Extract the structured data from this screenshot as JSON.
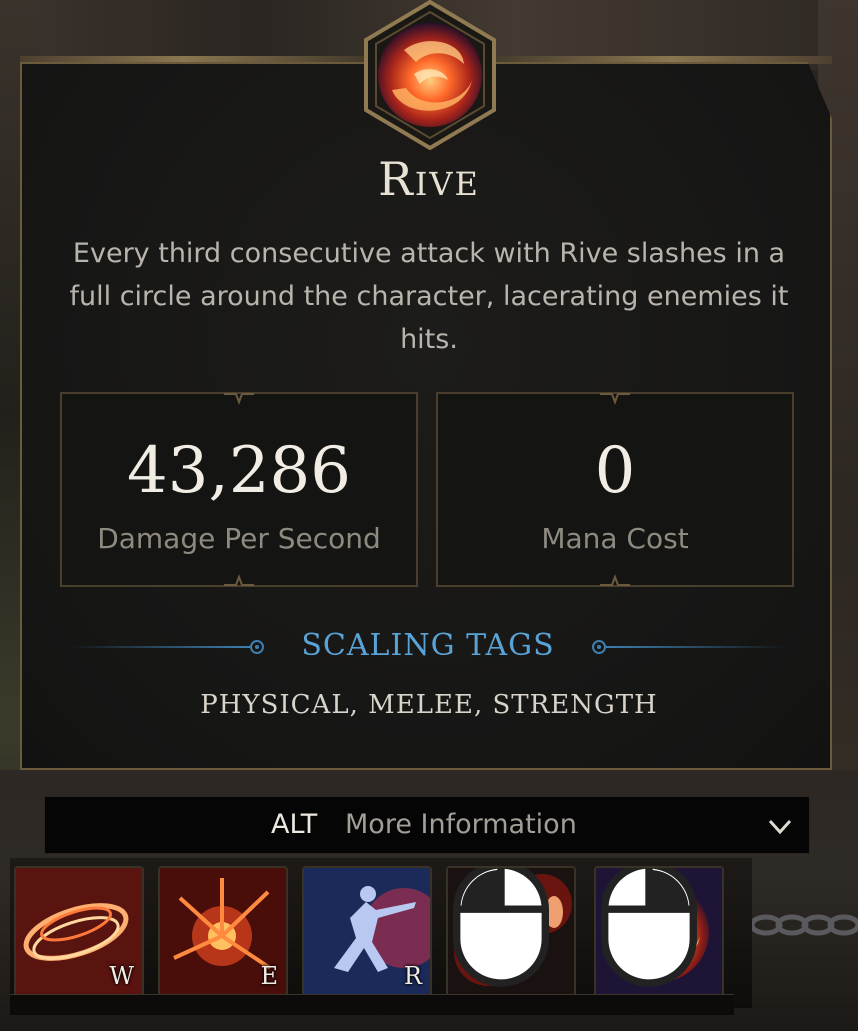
{
  "skill": {
    "name": "Rive",
    "description": "Every third consecutive attack with Rive slashes in a full circle around the character, lacerating enemies it hits.",
    "icon": "fire-swirl-icon"
  },
  "stats": [
    {
      "value": "43,286",
      "label": "Damage Per Second"
    },
    {
      "value": "0",
      "label": "Mana Cost"
    }
  ],
  "scaling": {
    "title": "SCALING TAGS",
    "tags": "PHYSICAL, MELEE, STRENGTH"
  },
  "more_info": {
    "key": "ALT",
    "label": "More Information"
  },
  "skillbar": [
    {
      "key": "W",
      "icon": "spinning-slash-icon"
    },
    {
      "key": "E",
      "icon": "fire-burst-icon"
    },
    {
      "key": "R",
      "icon": "lunge-icon"
    },
    {
      "key": "",
      "icon": "footsteps-icon",
      "input": "left-mouse"
    },
    {
      "key": "",
      "icon": "fire-swirl-icon",
      "input": "right-mouse"
    }
  ],
  "colors": {
    "accent_blue": "#5aa3d6",
    "gold_border": "#6b5a3c",
    "panel_bg": "#161615"
  }
}
